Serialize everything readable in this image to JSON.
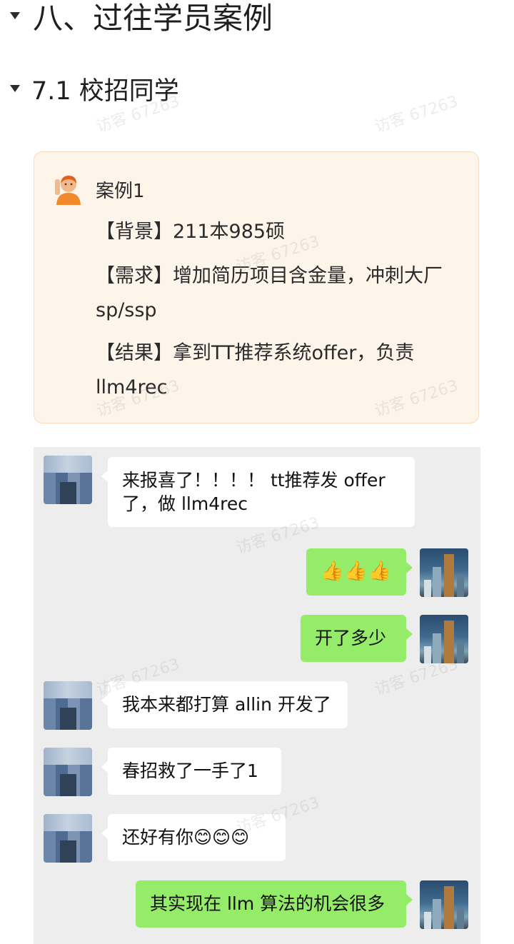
{
  "headings": {
    "section8": "八、过往学员案例",
    "section71": "7.1 校招同学"
  },
  "callout": {
    "icon": "person-raising-hand-icon",
    "title": "案例1",
    "lines": [
      "【背景】211本985硕",
      "【需求】增加简历项目含金量，冲刺大厂sp/ssp",
      "【结果】拿到TT推荐系统offer，负责llm4rec"
    ]
  },
  "chat": {
    "messages": [
      {
        "side": "left",
        "text": "来报喜了！！！！ tt推荐发 offer了，做 llm4rec"
      },
      {
        "side": "right",
        "text": "👍👍👍"
      },
      {
        "side": "right",
        "text": "开了多少"
      },
      {
        "side": "left",
        "text": "我本来都打算 allin 开发了"
      },
      {
        "side": "left",
        "text": "春招救了一手了1"
      },
      {
        "side": "left",
        "text": "还好有你😊😊😊"
      },
      {
        "side": "right",
        "text": "其实现在 llm 算法的机会很多"
      }
    ]
  },
  "watermark": "访客 67263",
  "colors": {
    "callout_bg": "#fdf4ea",
    "callout_border": "#f7dcc0",
    "chat_bg": "#ededed",
    "bubble_self": "#95ec69",
    "bubble_other": "#ffffff"
  }
}
